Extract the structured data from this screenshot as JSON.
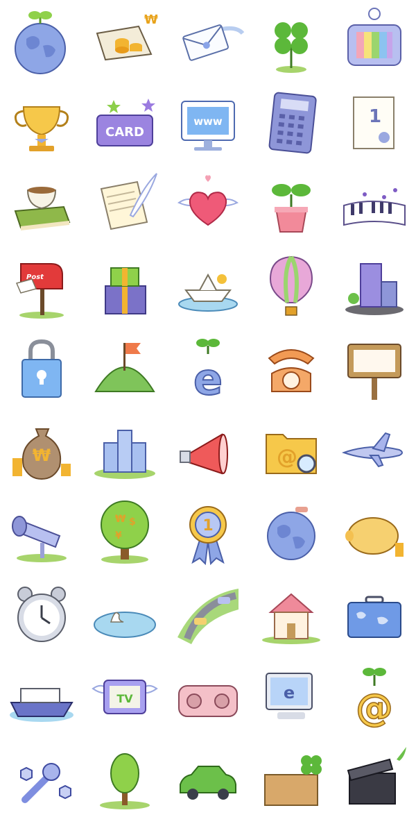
{
  "sheet": {
    "card_label": "CARD",
    "www_label": "www",
    "post_label": "Post",
    "tv_label": "TV",
    "won_symbol": "₩",
    "dollar_symbol": "$",
    "yen_symbol": "¥",
    "euro_symbol": "€",
    "email_symbol": "@",
    "e_symbol": "e",
    "number_one": "1"
  },
  "icons": [
    "globe-sprout-icon",
    "laptop-coins-icon",
    "envelope-icon",
    "clover-icon",
    "tv-color-bars-icon",
    "trophy-icon",
    "card-sign-icon",
    "www-monitor-icon",
    "calculator-icon",
    "certificate-icon",
    "teacup-book-icon",
    "letter-quill-icon",
    "winged-heart-icon",
    "potted-sprout-icon",
    "piano-keys-icon",
    "mailbox-icon",
    "gift-boxes-icon",
    "paper-boat-icon",
    "hot-air-balloon-icon",
    "city-buildings-icon",
    "padlock-bag-icon",
    "hill-flag-icon",
    "e-sprout-icon",
    "rotary-telephone-icon",
    "wooden-signboard-icon",
    "money-bag-icon",
    "castle-icon",
    "megaphone-icon",
    "folder-search-icon",
    "airplane-icon",
    "telescope-icon",
    "money-tree-icon",
    "medal-icon",
    "world-travel-icon",
    "piggy-bank-icon",
    "alarm-clock-icon",
    "pond-swan-icon",
    "road-cars-icon",
    "house-icon",
    "map-suitcase-icon",
    "cruise-ship-icon",
    "winged-tv-icon",
    "radio-cassette-icon",
    "computer-e-icon",
    "at-sprout-icon",
    "wrench-nuts-icon",
    "tree-icon",
    "green-car-icon",
    "parcel-clover-icon",
    "clapperboard-icon"
  ]
}
